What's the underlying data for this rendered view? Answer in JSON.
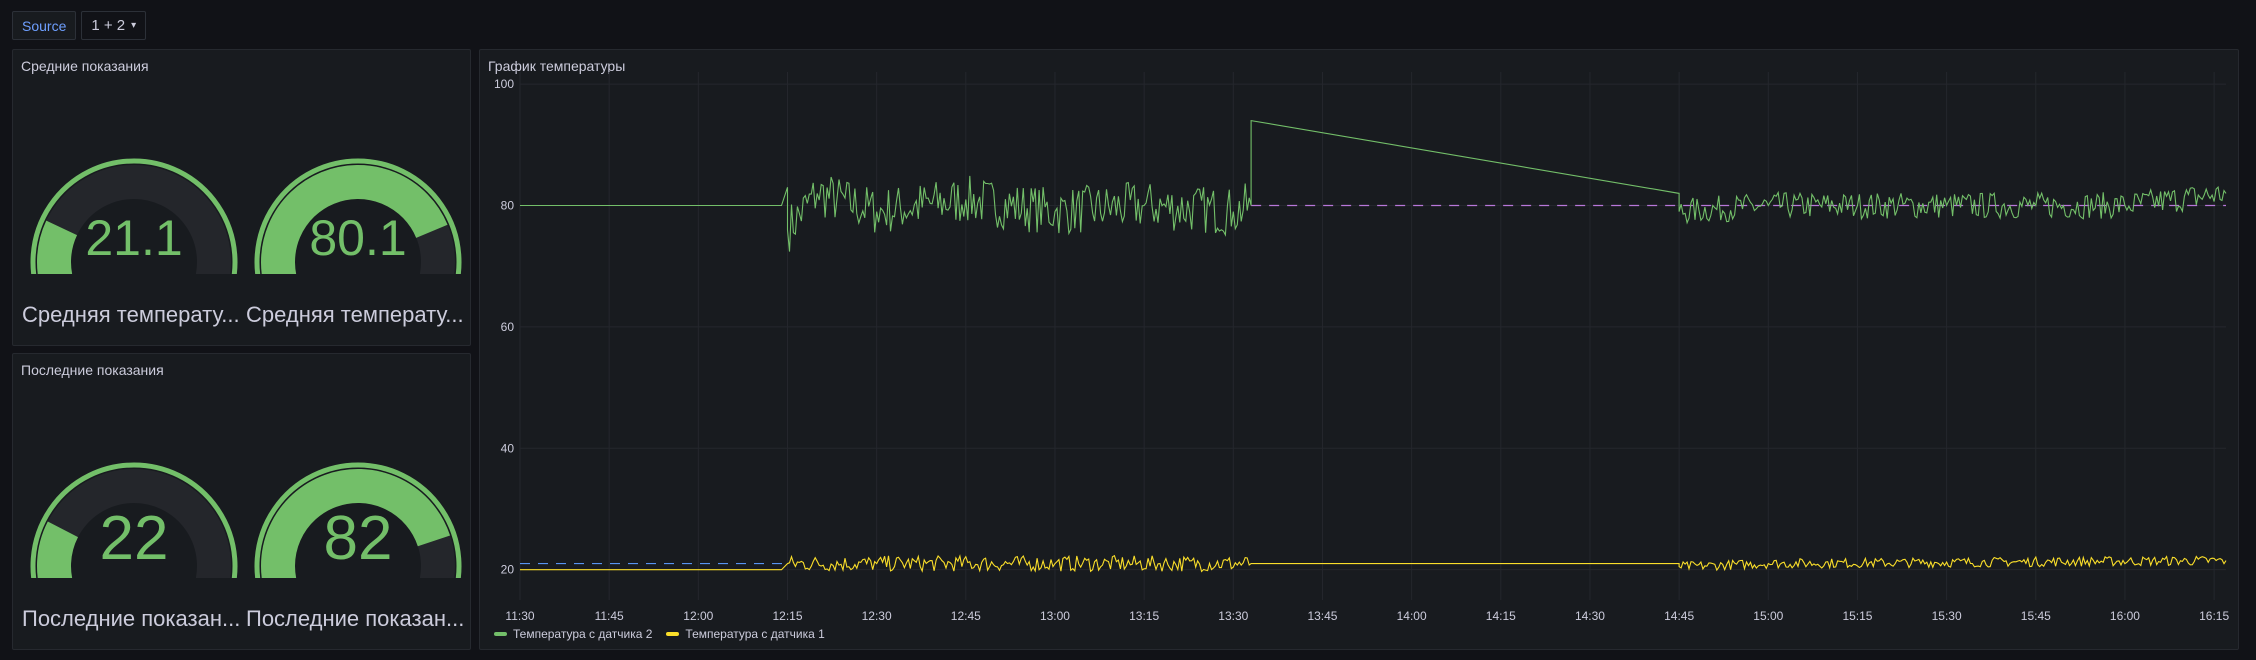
{
  "toolbar": {
    "variable_label": "Source",
    "variable_value": "1 + 2"
  },
  "panels": {
    "avg": {
      "title": "Средние показания",
      "gauges": [
        {
          "value": "21.1",
          "fraction": 0.211,
          "label": "Средняя температу..."
        },
        {
          "value": "80.1",
          "fraction": 0.801,
          "label": "Средняя температу..."
        }
      ]
    },
    "last": {
      "title": "Последние показания",
      "gauges": [
        {
          "value": "22",
          "fraction": 0.22,
          "label": "Последние показан..."
        },
        {
          "value": "82",
          "fraction": 0.82,
          "label": "Последние показан..."
        }
      ]
    },
    "chart": {
      "title": "График температуры"
    }
  },
  "colors": {
    "green": "#73bf69",
    "yellow": "#fade2a",
    "blue_threshold": "#5794f2",
    "purple_threshold": "#b877d9",
    "track": "#24262b"
  },
  "chart_data": {
    "type": "line",
    "title": "График температуры",
    "xlabel": "",
    "ylabel": "",
    "x_ticks": [
      "11:30",
      "11:45",
      "12:00",
      "12:15",
      "12:30",
      "12:45",
      "13:00",
      "13:15",
      "13:30",
      "13:45",
      "14:00",
      "14:15",
      "14:30",
      "14:45",
      "15:00",
      "15:15",
      "15:30",
      "15:45",
      "16:00",
      "16:15"
    ],
    "y_ticks": [
      20,
      40,
      60,
      80,
      100
    ],
    "xlim": [
      "11:30",
      "16:17"
    ],
    "ylim": [
      15,
      102
    ],
    "grid": true,
    "legend_position": "bottom-left",
    "series": [
      {
        "name": "Температура с датчика 2",
        "color": "#73bf69",
        "points": [
          [
            "11:30",
            80
          ],
          [
            "12:14",
            80
          ],
          [
            "12:15",
            83
          ],
          [
            "12:15",
            76
          ],
          [
            "12:20",
            82
          ],
          [
            "12:30",
            79
          ],
          [
            "12:45",
            81
          ],
          [
            "13:00",
            79
          ],
          [
            "13:15",
            80
          ],
          [
            "13:30",
            79
          ],
          [
            "13:33",
            80
          ],
          [
            "13:33",
            94
          ],
          [
            "14:45",
            82
          ],
          [
            "14:45",
            79
          ],
          [
            "15:00",
            80
          ],
          [
            "15:15",
            80
          ],
          [
            "15:30",
            80
          ],
          [
            "15:45",
            80
          ],
          [
            "16:00",
            80
          ],
          [
            "16:17",
            82
          ]
        ],
        "noise": [
          {
            "from": "12:15",
            "to": "13:33",
            "amplitude": 4
          },
          {
            "from": "14:45",
            "to": "16:17",
            "amplitude": 2.2
          }
        ]
      },
      {
        "name": "Температура с датчика 1",
        "color": "#fade2a",
        "points": [
          [
            "11:30",
            20
          ],
          [
            "12:14",
            20
          ],
          [
            "12:15",
            21
          ],
          [
            "12:30",
            21
          ],
          [
            "13:00",
            21
          ],
          [
            "13:33",
            21
          ],
          [
            "14:45",
            21
          ],
          [
            "14:45",
            20.5
          ],
          [
            "15:00",
            21
          ],
          [
            "16:17",
            21.5
          ]
        ],
        "noise": [
          {
            "from": "12:15",
            "to": "13:33",
            "amplitude": 1.3
          },
          {
            "from": "14:45",
            "to": "16:17",
            "amplitude": 0.8
          }
        ]
      }
    ],
    "thresholds": [
      {
        "value": 80,
        "color": "#b877d9",
        "style": "dashed",
        "from": "13:33",
        "to": "16:17"
      },
      {
        "value": 21,
        "color": "#5794f2",
        "style": "dashed",
        "from": "11:30",
        "to": "12:15"
      }
    ]
  }
}
